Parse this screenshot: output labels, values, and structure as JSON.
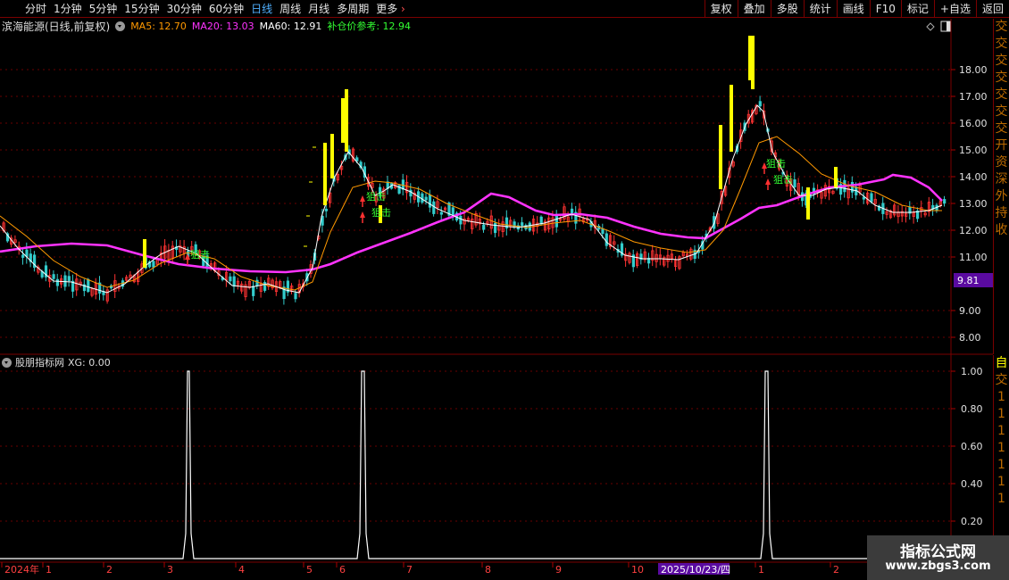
{
  "toolbar": {
    "periods": [
      "分时",
      "1分钟",
      "5分钟",
      "15分钟",
      "30分钟",
      "60分钟",
      "日线",
      "周线",
      "月线",
      "多周期",
      "更多"
    ],
    "active_period": "日线",
    "right_buttons": [
      "复权",
      "叠加",
      "多股",
      "统计",
      "画线",
      "F10",
      "标记",
      "+自选",
      "返回"
    ]
  },
  "main_chart": {
    "stock_title": "滨海能源(日线,前复权)",
    "ma5_label": "MA5: 12.70",
    "ma20_label": "MA20: 13.03",
    "ma60_label": "MA60: 12.91",
    "ref_label": "补仓价参考: 12.94",
    "price_ticks": [
      "18.00",
      "17.00",
      "16.00",
      "15.00",
      "14.00",
      "13.00",
      "12.00",
      "11.00",
      "9.00",
      "8.00"
    ],
    "current_price_badge": "9.81",
    "signal_text": "狙击"
  },
  "side_strip_chars": [
    "交",
    "交",
    "交",
    "交",
    "交",
    "交",
    "交",
    "开",
    "资",
    "深",
    "外",
    "持",
    "收"
  ],
  "sub_chart": {
    "indicator_title": "股朋指标网",
    "xg_label": "XG: 0.00",
    "value_ticks": [
      "1.00",
      "0.80",
      "0.60",
      "0.40",
      "0.20"
    ],
    "side_chars": [
      "自",
      "交",
      "1",
      "1",
      "1",
      "1",
      "1",
      "1",
      "1"
    ]
  },
  "date_axis": {
    "labels": [
      "2024年",
      "1",
      "2",
      "3",
      "4",
      "5",
      "6",
      "7",
      "8",
      "9",
      "10",
      "1",
      "2",
      "1"
    ],
    "cursor_date": "2025/10/23/四"
  },
  "watermark": {
    "title": "指标公式网",
    "url": "www.zbgs3.com"
  },
  "colors": {
    "ma5": "#ffffff",
    "ma20": "#ff9900",
    "ma60": "#ff33ff",
    "ref": "#33ff33",
    "up_candle": "#ff3333",
    "down_candle": "#33cccc",
    "limit_up": "#ffff00",
    "grid": "#7a0000",
    "badge_bg": "#5a0aa0"
  }
}
